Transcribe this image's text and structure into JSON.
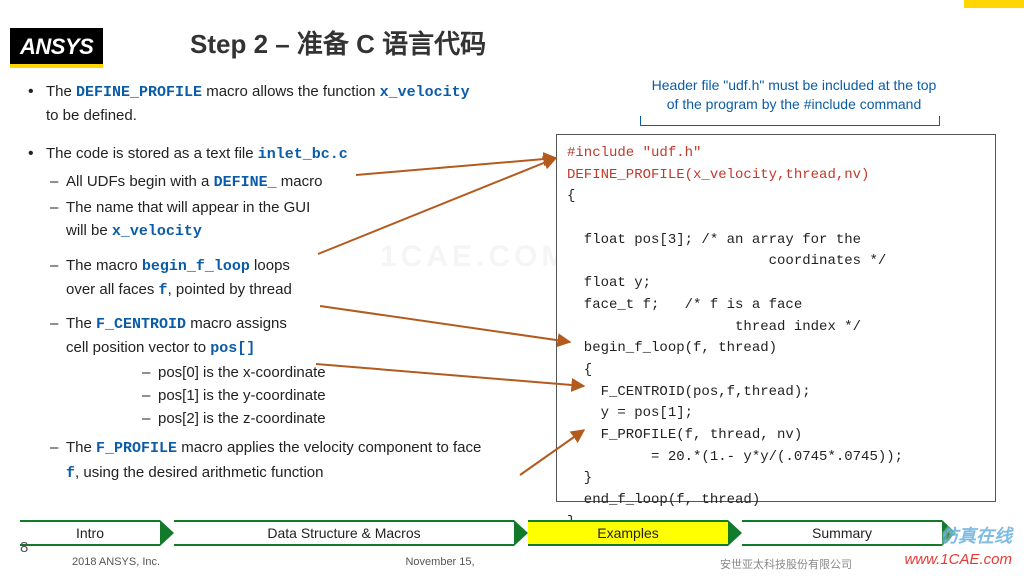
{
  "brand": "ANSYS",
  "title": "Step 2 – 准备 C 语言代码",
  "header_note_1": "Header file \"udf.h\" must be included at the top",
  "header_note_2": "of the program by the #include command",
  "bullet1_a": "The ",
  "bullet1_code": "DEFINE_PROFILE",
  "bullet1_b": " macro allows the function ",
  "bullet1_code2": "x_velocity",
  "bullet1_c": "to be defined.",
  "bullet2_a": "The code is stored as a text file ",
  "bullet2_code": "inlet_bc.c",
  "sub1_a": "All UDFs begin with a ",
  "sub1_code": "DEFINE_",
  "sub1_b": " macro",
  "sub2_a": "The name that will appear in the GUI",
  "sub2_b": "will be ",
  "sub2_code": "x_velocity",
  "sub3_a": "The macro ",
  "sub3_code": "begin_f_loop",
  "sub3_b": " loops",
  "sub3_c": "over all faces ",
  "sub3_code2": "f",
  "sub3_d": ", pointed by thread",
  "sub4_a": "The ",
  "sub4_code": "F_CENTROID",
  "sub4_b": " macro assigns",
  "sub4_c": "cell position vector to ",
  "sub4_code2": "pos[]",
  "sub4_x": "pos[0] is the x-coordinate",
  "sub4_y": "pos[1] is the y-coordinate",
  "sub4_z": "pos[2] is the z-coordinate",
  "sub5_a": "The ",
  "sub5_code": "F_PROFILE",
  "sub5_b": " macro applies the velocity component to face",
  "sub5_code2": "f",
  "sub5_c": ",  using the desired arithmetic function",
  "code": {
    "l1": "#include \"udf.h\"",
    "l2": "DEFINE_PROFILE(x_velocity,thread,nv)",
    "l3": "{",
    "l4": "",
    "l5": "  float pos[3]; /* an array for the",
    "l6": "                        coordinates */",
    "l7": "  float y;",
    "l8": "  face_t f;   /* f is a face",
    "l9": "                    thread index */",
    "l10": "  begin_f_loop(f, thread)",
    "l11": "  {",
    "l12": "    F_CENTROID(pos,f,thread);",
    "l13": "    y = pos[1];",
    "l14": "    F_PROFILE(f, thread, nv)",
    "l15": "          = 20.*(1.- y*y/(.0745*.0745));",
    "l16": "  }",
    "l17": "  end_f_loop(f, thread)",
    "l18": "}"
  },
  "nav": [
    "Intro",
    "Data Structure & Macros",
    "Examples",
    "Summary"
  ],
  "footer_left": "2018  ANSYS, Inc.",
  "footer_mid": "November 15,",
  "footer_company": "安世亚太科技股份有限公司",
  "page": "8",
  "watermark_bg": "1CAE.COM",
  "watermark_cn": "仿真在线",
  "watermark_url": "www.1CAE.com"
}
